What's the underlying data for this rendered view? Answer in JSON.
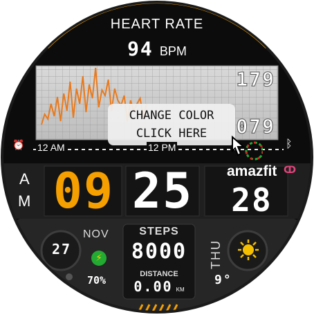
{
  "heart": {
    "title": "HEART RATE",
    "value": "94",
    "unit": "BPM",
    "scale_max": "179",
    "scale_mid": "079"
  },
  "chart_axis": {
    "start": "12 AM",
    "mid": "12 PM"
  },
  "tooltip": {
    "line1": "CHANGE COLOR",
    "line2": "CLICK HERE"
  },
  "time": {
    "ampm_a": "A",
    "ampm_m": "M",
    "hours": "09",
    "minutes": "25",
    "seconds": "28"
  },
  "brand": "amazfit",
  "date": {
    "day": "27",
    "month": "NOV",
    "weekday": "THU"
  },
  "battery": {
    "label": "70%",
    "value": 70
  },
  "steps": {
    "label": "STEPS",
    "value": "8000"
  },
  "distance": {
    "label": "DISTANCE",
    "value": "0.00",
    "unit": "KM"
  },
  "weather": {
    "temp": "9°",
    "icon": "sun-icon"
  },
  "colors": {
    "accent": "#f5a000",
    "chart_line": "#e87a1e",
    "bg": "#0c0c0c",
    "panel": "#2a2a2a",
    "check": "#22aa33"
  }
}
